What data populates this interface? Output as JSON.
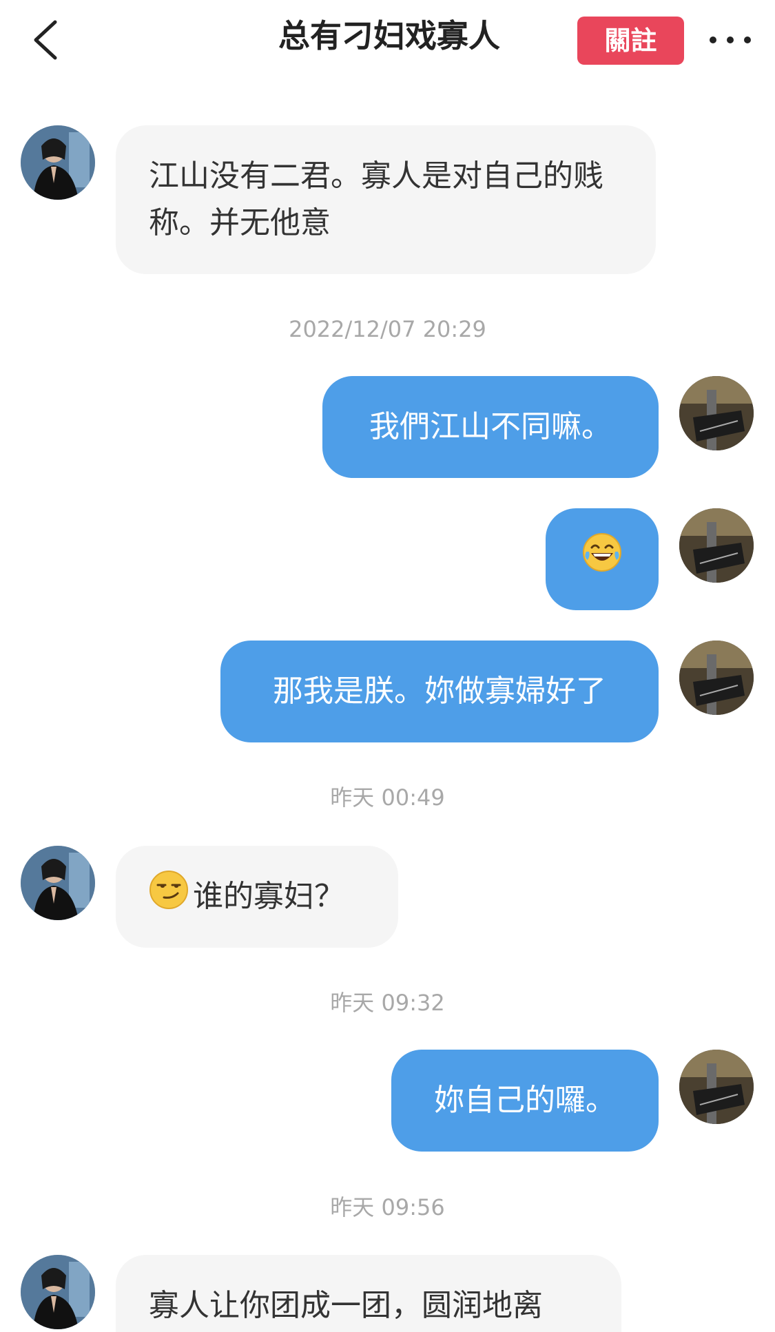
{
  "header": {
    "title": "总有刁妇戏寡人",
    "follow_label": "關註"
  },
  "timestamps": [
    "2022/12/07 20:29",
    "昨天 00:49",
    "昨天 09:32",
    "昨天 09:56"
  ],
  "messages": [
    {
      "sender": "other",
      "text": "江山没有二君。寡人是对自己的贱称。并无他意"
    },
    {
      "sender": "me",
      "text": "我們江山不同嘛。"
    },
    {
      "sender": "me",
      "emoji": "laughing-tears-emoji"
    },
    {
      "sender": "me",
      "text": "那我是朕。妳做寡婦好了"
    },
    {
      "sender": "other",
      "emoji": "smirk-emoji",
      "text": "谁的寡妇？"
    },
    {
      "sender": "me",
      "text": "妳自己的囉。"
    },
    {
      "sender": "other",
      "text": "寡人让你团成一团，圆润地离"
    }
  ],
  "colors": {
    "follow_button": "#e9465b",
    "my_bubble": "#4e9ee8",
    "their_bubble": "#f5f5f5",
    "timestamp": "#a8a8a8"
  }
}
